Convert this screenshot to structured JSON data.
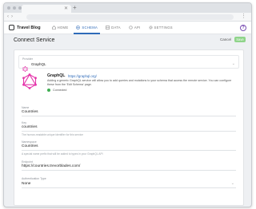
{
  "app": {
    "brand": "Travel Blog",
    "help_label": "?"
  },
  "nav": {
    "items": [
      {
        "label": "HOME",
        "icon": "home-icon",
        "active": false
      },
      {
        "label": "SCHEMA",
        "icon": "schema-icon",
        "active": true
      },
      {
        "label": "DATA",
        "icon": "data-icon",
        "active": false
      },
      {
        "label": "API",
        "icon": "api-icon",
        "active": false
      },
      {
        "label": "SETTINGS",
        "icon": "settings-icon",
        "active": false
      }
    ]
  },
  "page": {
    "title": "Connect Service",
    "cancel_label": "Cancel",
    "save_label": "Save"
  },
  "service": {
    "label": "Provider",
    "value": "GraphQL",
    "icon": "graphql-icon"
  },
  "description": {
    "title": "GraphQL",
    "link": "https://graphql.org/",
    "text": "Adding a generic GraphQL service will allow you to add queries and mutations to your                    schema that access the remote service. You can configure these from the 'Edit Schema' page.",
    "status": "Connected"
  },
  "fields": {
    "name": {
      "label": "Name",
      "value": "Countries"
    },
    "key": {
      "label": "Key",
      "value": "countries",
      "hint": "The human-readable unique identifier for this service"
    },
    "namespace": {
      "label": "Namespace",
      "value": "Countries",
      "hint": "A special name prefix that will be added to types in your GraphQL API"
    },
    "endpoint": {
      "label": "Endpoint",
      "value": "https://countries.trevorblades.com/"
    },
    "authentication": {
      "label": "Authentication Type",
      "value": "None"
    }
  },
  "colors": {
    "accent": "#2e6ab8",
    "graphql": "#e535ab",
    "save_button": "#8fd48a",
    "connected": "#3fae52"
  }
}
